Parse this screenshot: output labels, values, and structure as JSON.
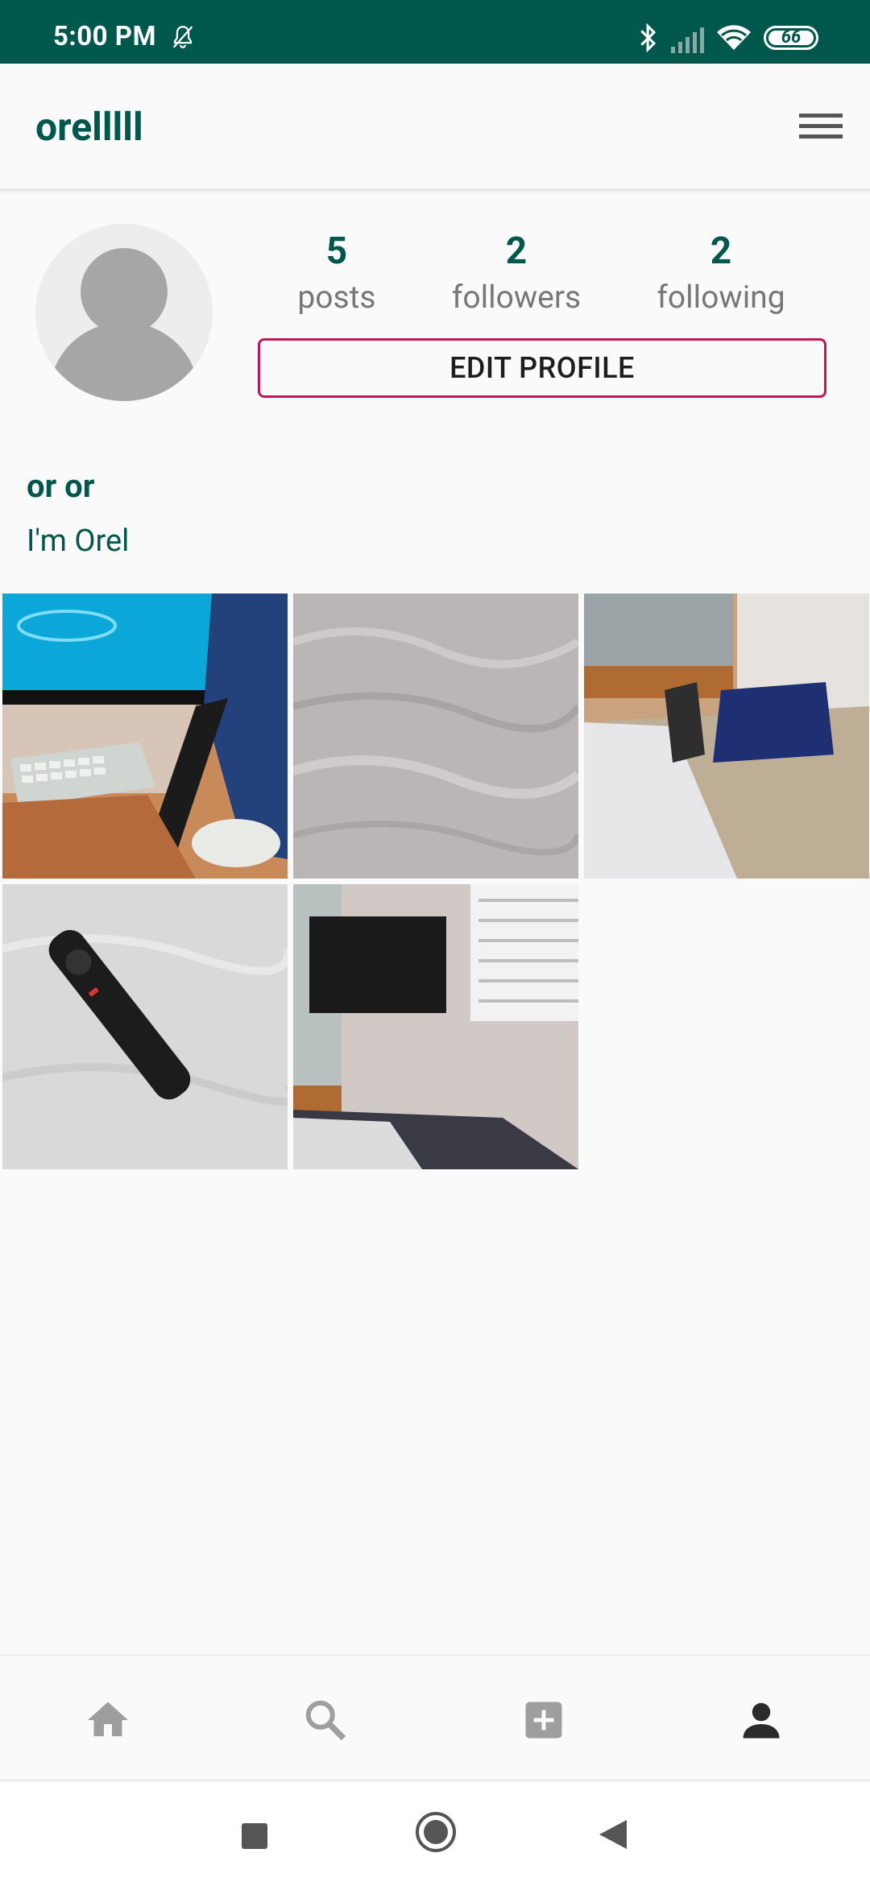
{
  "status_bar": {
    "time": "5:00 PM",
    "battery": "66",
    "icons": [
      "bell-off-icon",
      "bluetooth-icon",
      "signal-icon",
      "wifi-icon",
      "battery-icon"
    ]
  },
  "app_bar": {
    "title": "orelllll",
    "menu_icon": "hamburger-menu-icon"
  },
  "profile": {
    "stats": [
      {
        "value": "5",
        "label": "posts"
      },
      {
        "value": "2",
        "label": "followers"
      },
      {
        "value": "2",
        "label": "following"
      }
    ],
    "edit_button": "EDIT PROFILE",
    "full_name": "or or",
    "bio": "I'm Orel"
  },
  "posts": [
    {
      "subject": "imac-desk-backpack"
    },
    {
      "subject": "gray-fabric"
    },
    {
      "subject": "bedroom-bags"
    },
    {
      "subject": "tv-remote"
    },
    {
      "subject": "wall-tv-window"
    }
  ],
  "bottom_nav": [
    {
      "icon": "home-icon",
      "active": false
    },
    {
      "icon": "search-icon",
      "active": false
    },
    {
      "icon": "add-post-icon",
      "active": false
    },
    {
      "icon": "profile-icon",
      "active": true
    }
  ],
  "system_nav": [
    "recents-icon",
    "home-circle-icon",
    "back-icon"
  ],
  "colors": {
    "primary_dark": "#00574b",
    "accent": "#c2185b",
    "background": "#fafafa"
  }
}
